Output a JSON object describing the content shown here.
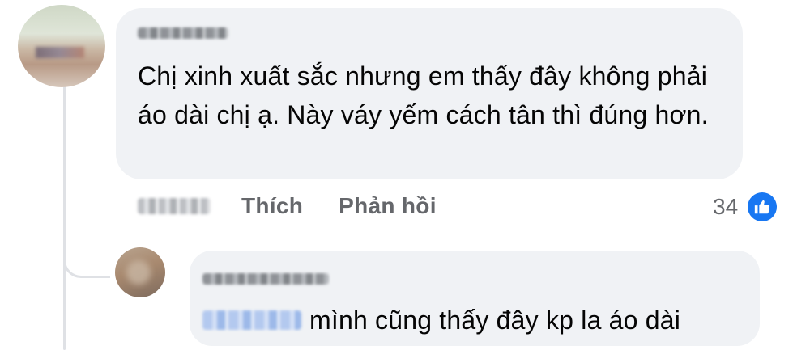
{
  "comment": {
    "text": "Chị xinh xuất sắc nhưng em thấy đây không phải áo dài chị ạ. Này váy yếm cách tân thì đúng hơn.",
    "actions": {
      "like_label": "Thích",
      "reply_label": "Phản hồi"
    },
    "reaction": {
      "count": "34",
      "icon": "like-icon",
      "color": "#1877f2"
    }
  },
  "reply": {
    "text": "mình cũng thấy đây kp la áo dài"
  },
  "colors": {
    "bubble": "#f0f2f5",
    "action_text": "#65676b",
    "accent": "#1877f2"
  }
}
